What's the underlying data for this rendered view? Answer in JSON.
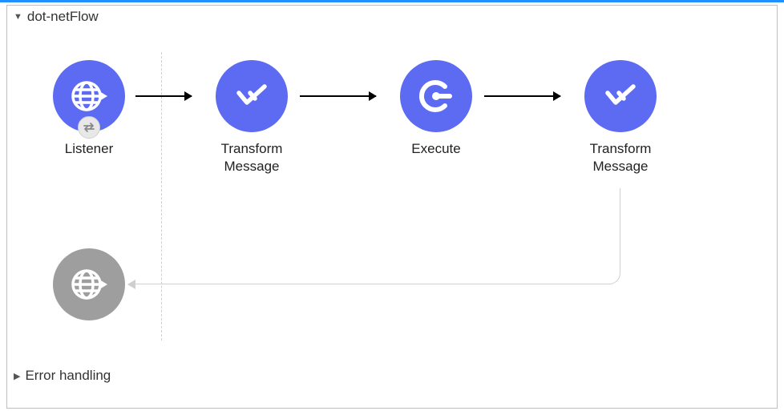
{
  "flow": {
    "title": "dot-netFlow",
    "errorSection": "Error handling",
    "nodes": [
      {
        "label": "Listener"
      },
      {
        "label": "Transform\nMessage"
      },
      {
        "label": "Execute"
      },
      {
        "label": "Transform\nMessage"
      }
    ]
  },
  "colors": {
    "accent": "#5c6bf2",
    "topBar": "#1e90ff",
    "muted": "#9e9e9e"
  }
}
